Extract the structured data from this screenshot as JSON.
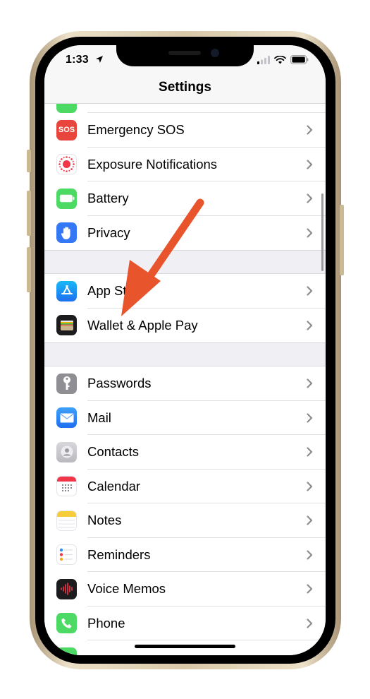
{
  "status_bar": {
    "time": "1:33"
  },
  "nav": {
    "title": "Settings"
  },
  "groups": [
    {
      "items": [
        {
          "label": "Emergency SOS",
          "icon": "sos-icon",
          "color": "#e8453c",
          "badge": "SOS"
        },
        {
          "label": "Exposure Notifications",
          "icon": "exposure-notifications-icon",
          "color": "#ffffff"
        },
        {
          "label": "Battery",
          "icon": "battery-icon",
          "color": "#4cd964"
        },
        {
          "label": "Privacy",
          "icon": "hand-icon",
          "color": "#3478f6"
        }
      ]
    },
    {
      "items": [
        {
          "label": "App Store",
          "icon": "app-store-icon",
          "color": "#1e8ff7"
        },
        {
          "label": "Wallet & Apple Pay",
          "icon": "wallet-icon",
          "color": "#1c1c1e"
        }
      ]
    },
    {
      "items": [
        {
          "label": "Passwords",
          "icon": "key-icon",
          "color": "#8e8e93"
        },
        {
          "label": "Mail",
          "icon": "mail-icon",
          "color": "#2f8cf6"
        },
        {
          "label": "Contacts",
          "icon": "contacts-icon",
          "color": "#c8c8cc"
        },
        {
          "label": "Calendar",
          "icon": "calendar-icon",
          "color": "#ffffff"
        },
        {
          "label": "Notes",
          "icon": "notes-icon",
          "color": "#ffffff"
        },
        {
          "label": "Reminders",
          "icon": "reminders-icon",
          "color": "#ffffff"
        },
        {
          "label": "Voice Memos",
          "icon": "voice-memos-icon",
          "color": "#1c1c1e"
        },
        {
          "label": "Phone",
          "icon": "phone-icon",
          "color": "#4cd964"
        }
      ]
    }
  ],
  "annotation_color": "#e8542c"
}
